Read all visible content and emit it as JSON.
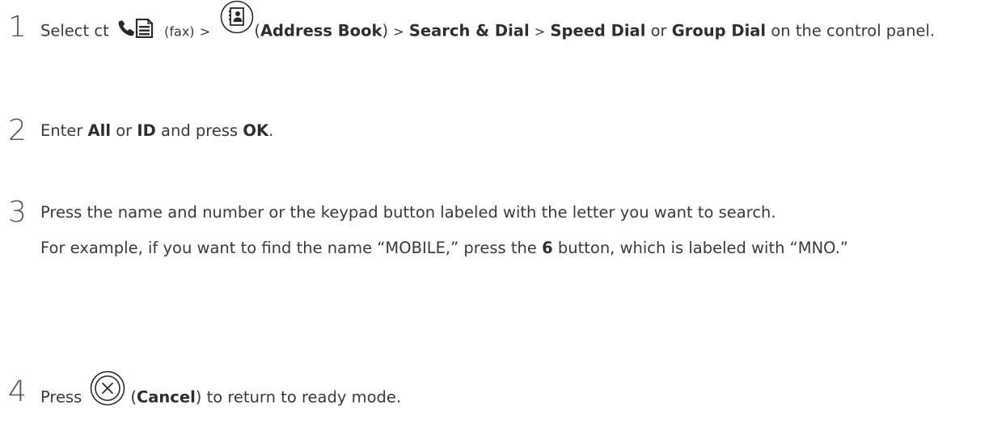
{
  "steps": [
    {
      "number": "1",
      "select": "Select ct",
      "fax": "(fax)",
      "sep": ">",
      "open_paren": "(",
      "address_book": "Address Book",
      "close_paren": ")",
      "search_dial": "Search & Dial",
      "speed_dial": "Speed Dial",
      "or": "or",
      "group_dial": "Group Dial",
      "tail": "on the control panel."
    },
    {
      "number": "2",
      "enter": "Enter",
      "all": "All",
      "or": "or",
      "id": "ID",
      "press": "and press",
      "ok": "OK",
      "period": "."
    },
    {
      "number": "3",
      "line1": "Press the name and number or the keypad button labeled with the letter you want to search.",
      "example_a": "For example, if you want to find the name “MOBILE,” press the",
      "six": "6",
      "example_b": "button, which is labeled with “MNO.”"
    },
    {
      "number": "4",
      "press": "Press",
      "open_paren": "(",
      "cancel": "Cancel",
      "tail": ") to return to ready mode."
    }
  ],
  "icons": {
    "fax": "fax-icon",
    "address_book": "address-book-icon",
    "cancel": "cancel-icon"
  }
}
